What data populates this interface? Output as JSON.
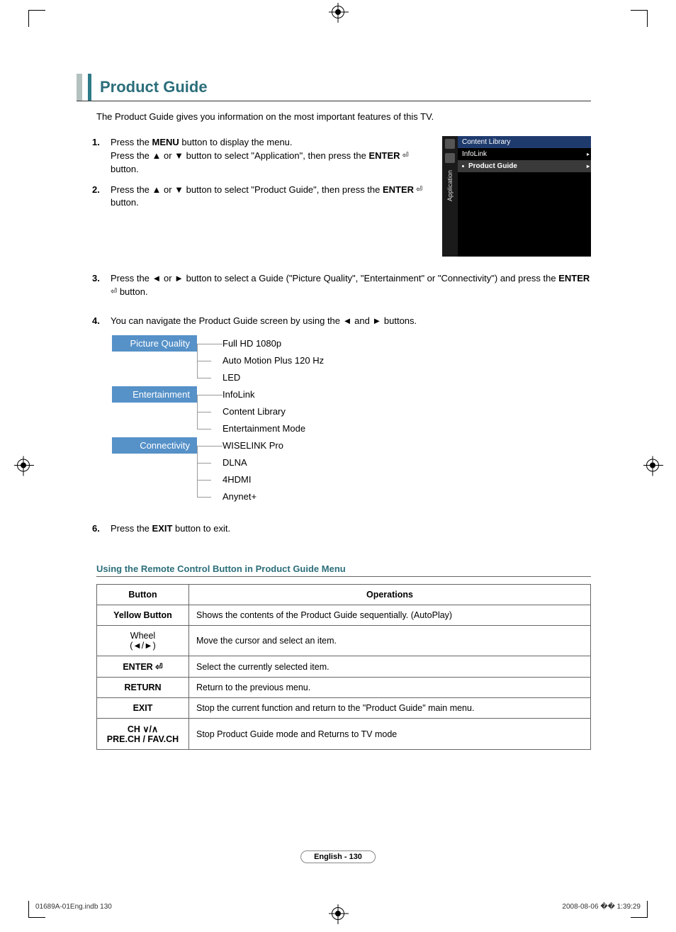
{
  "title": "Product Guide",
  "intro": "The Product Guide gives you information on the most important features of this TV.",
  "steps": {
    "s1": {
      "num": "1.",
      "part1": "Press the ",
      "bold1": "MENU",
      "part2": " button to display the menu.",
      "line2a": "Press the ▲ or ▼ button to select \"Application\", then press the ",
      "bold2": "ENTER",
      "line2c": " button."
    },
    "s2": {
      "num": "2.",
      "part1": "Press the ▲ or ▼ button to select \"Product Guide\", then press the ",
      "bold1": "ENTER",
      "part2": " button."
    },
    "s3": {
      "num": "3.",
      "part1": "Press the ◄ or ► button to select a Guide (\"Picture Quality\", \"Entertainment\" or \"Connectivity\") and press the ",
      "bold1": "ENTER",
      "part2": " button."
    },
    "s4": {
      "num": "4.",
      "text": "You can navigate the Product Guide screen by using the ◄ and ► buttons."
    },
    "s6": {
      "num": "6.",
      "part1": "Press the ",
      "bold1": "EXIT",
      "part2": " button to exit."
    }
  },
  "osd": {
    "side_label": "Application",
    "header": "Content Library",
    "item1": "InfoLink",
    "item2": "Product Guide"
  },
  "tree": {
    "cat1": {
      "label": "Picture Quality",
      "items": [
        "Full HD 1080p",
        "Auto Motion Plus 120 Hz",
        "LED"
      ]
    },
    "cat2": {
      "label": "Entertainment",
      "items": [
        "InfoLink",
        "Content Library",
        "Entertainment Mode"
      ]
    },
    "cat3": {
      "label": "Connectivity",
      "items": [
        "WISELINK Pro",
        "DLNA",
        "4HDMI",
        "Anynet+"
      ]
    }
  },
  "subtitle": "Using the Remote Control Button in Product Guide Menu",
  "table": {
    "h1": "Button",
    "h2": "Operations",
    "rows": [
      {
        "btn": "Yellow Button",
        "btn_sub": "",
        "op": "Shows the contents of the Product Guide sequentially. (AutoPlay)"
      },
      {
        "btn": "Wheel",
        "btn_sub": "(◄/►)",
        "op": "Move the cursor and select an item."
      },
      {
        "btn": "ENTER ⏎",
        "btn_sub": "",
        "op": "Select the currently selected item."
      },
      {
        "btn": "RETURN",
        "btn_sub": "",
        "op": "Return to the previous menu."
      },
      {
        "btn": "EXIT",
        "btn_sub": "",
        "op": "Stop the current function and return to the \"Product Guide\" main menu."
      },
      {
        "btn": "CH ∨/∧",
        "btn_sub": "PRE.CH / FAV.CH",
        "op": "Stop Product Guide mode and Returns to TV mode"
      }
    ]
  },
  "footer": "English - 130",
  "meta_left": "01689A-01Eng.indb   130",
  "meta_right": "2008-08-06   �� 1:39:29"
}
